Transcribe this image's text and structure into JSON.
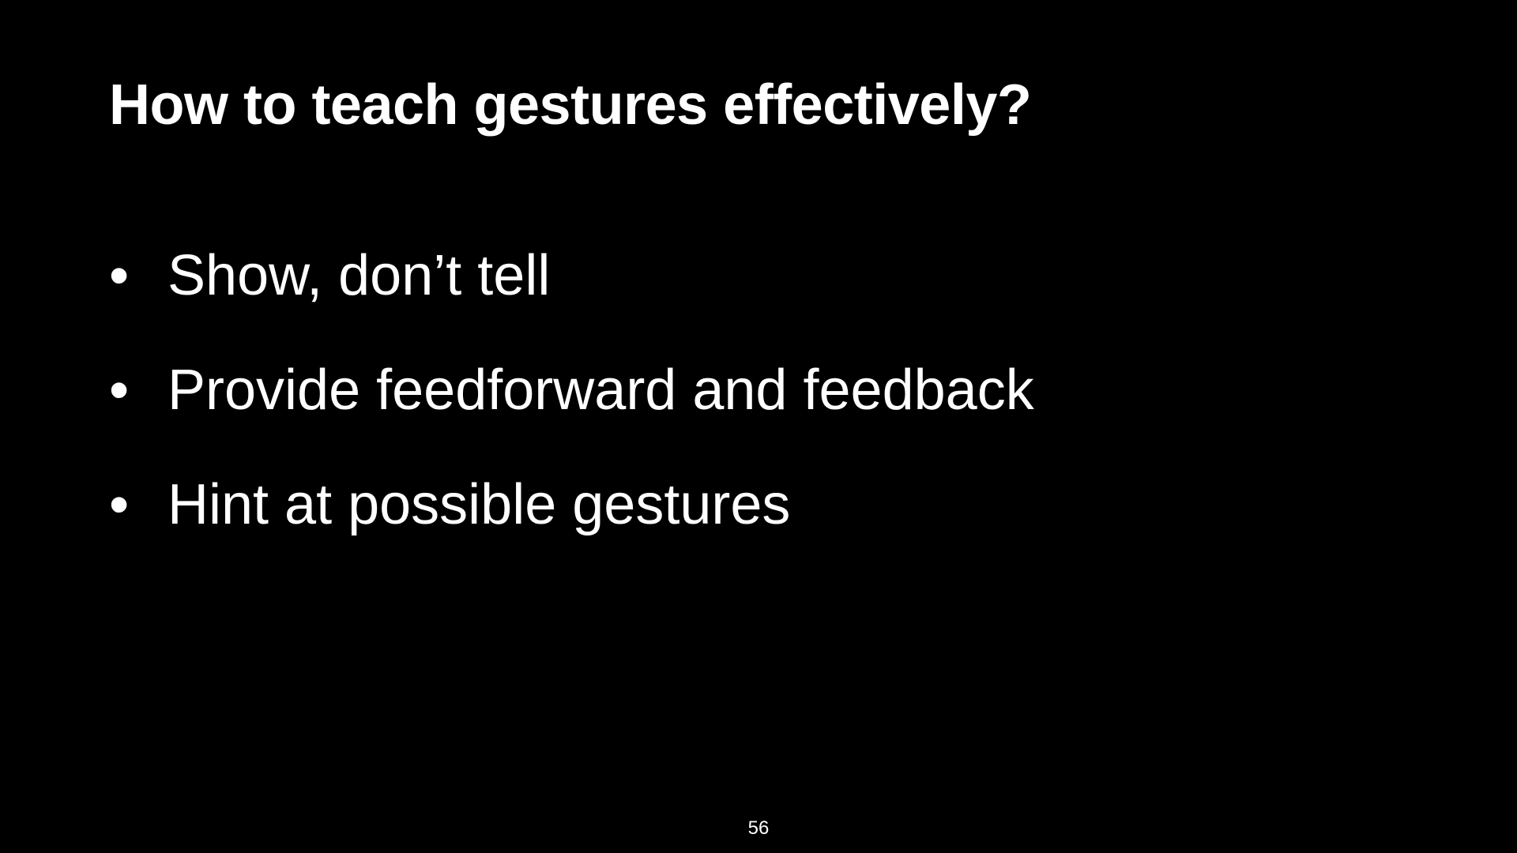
{
  "slide": {
    "title": "How to teach gestures effectively?",
    "bullets": [
      {
        "marker": "•",
        "text": "Show, don’t tell"
      },
      {
        "marker": "•",
        "text": "Provide feedforward and feedback"
      },
      {
        "marker": "•",
        "text": "Hint at possible gestures"
      }
    ],
    "page_number": "56"
  },
  "colors": {
    "background": "#000000",
    "text": "#ffffff"
  }
}
